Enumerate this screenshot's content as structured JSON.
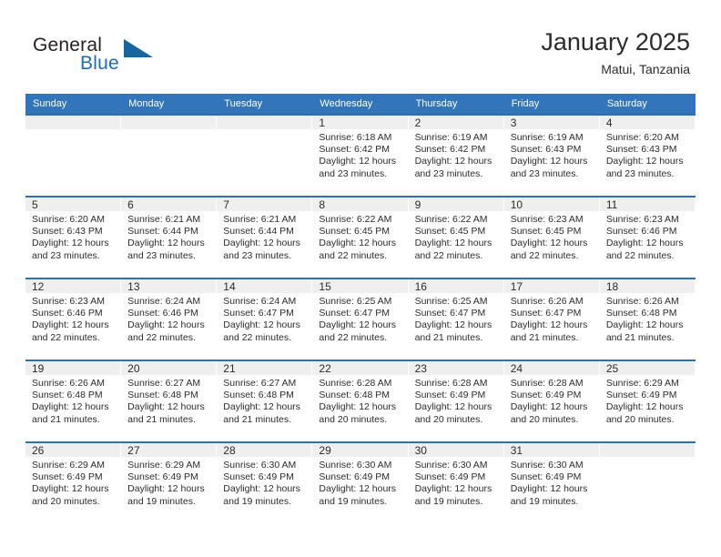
{
  "brand": {
    "name_part1": "General",
    "name_part2": "Blue",
    "triangle_color": "#15659e",
    "blue_color": "#1d6cb5"
  },
  "header": {
    "title": "January 2025",
    "subtitle": "Matui, Tanzania"
  },
  "theme": {
    "header_row_bg": "#3275bb",
    "row_divider": "#2f6fb0",
    "day_number_band_bg": "#efefef",
    "text": "#2b2b2b"
  },
  "weekdays": [
    "Sunday",
    "Monday",
    "Tuesday",
    "Wednesday",
    "Thursday",
    "Friday",
    "Saturday"
  ],
  "weeks": [
    [
      {
        "day": "",
        "sunrise": "",
        "sunset": "",
        "daylight1": "",
        "daylight2": ""
      },
      {
        "day": "",
        "sunrise": "",
        "sunset": "",
        "daylight1": "",
        "daylight2": ""
      },
      {
        "day": "",
        "sunrise": "",
        "sunset": "",
        "daylight1": "",
        "daylight2": ""
      },
      {
        "day": "1",
        "sunrise": "Sunrise: 6:18 AM",
        "sunset": "Sunset: 6:42 PM",
        "daylight1": "Daylight: 12 hours",
        "daylight2": "and 23 minutes."
      },
      {
        "day": "2",
        "sunrise": "Sunrise: 6:19 AM",
        "sunset": "Sunset: 6:42 PM",
        "daylight1": "Daylight: 12 hours",
        "daylight2": "and 23 minutes."
      },
      {
        "day": "3",
        "sunrise": "Sunrise: 6:19 AM",
        "sunset": "Sunset: 6:43 PM",
        "daylight1": "Daylight: 12 hours",
        "daylight2": "and 23 minutes."
      },
      {
        "day": "4",
        "sunrise": "Sunrise: 6:20 AM",
        "sunset": "Sunset: 6:43 PM",
        "daylight1": "Daylight: 12 hours",
        "daylight2": "and 23 minutes."
      }
    ],
    [
      {
        "day": "5",
        "sunrise": "Sunrise: 6:20 AM",
        "sunset": "Sunset: 6:43 PM",
        "daylight1": "Daylight: 12 hours",
        "daylight2": "and 23 minutes."
      },
      {
        "day": "6",
        "sunrise": "Sunrise: 6:21 AM",
        "sunset": "Sunset: 6:44 PM",
        "daylight1": "Daylight: 12 hours",
        "daylight2": "and 23 minutes."
      },
      {
        "day": "7",
        "sunrise": "Sunrise: 6:21 AM",
        "sunset": "Sunset: 6:44 PM",
        "daylight1": "Daylight: 12 hours",
        "daylight2": "and 23 minutes."
      },
      {
        "day": "8",
        "sunrise": "Sunrise: 6:22 AM",
        "sunset": "Sunset: 6:45 PM",
        "daylight1": "Daylight: 12 hours",
        "daylight2": "and 22 minutes."
      },
      {
        "day": "9",
        "sunrise": "Sunrise: 6:22 AM",
        "sunset": "Sunset: 6:45 PM",
        "daylight1": "Daylight: 12 hours",
        "daylight2": "and 22 minutes."
      },
      {
        "day": "10",
        "sunrise": "Sunrise: 6:23 AM",
        "sunset": "Sunset: 6:45 PM",
        "daylight1": "Daylight: 12 hours",
        "daylight2": "and 22 minutes."
      },
      {
        "day": "11",
        "sunrise": "Sunrise: 6:23 AM",
        "sunset": "Sunset: 6:46 PM",
        "daylight1": "Daylight: 12 hours",
        "daylight2": "and 22 minutes."
      }
    ],
    [
      {
        "day": "12",
        "sunrise": "Sunrise: 6:23 AM",
        "sunset": "Sunset: 6:46 PM",
        "daylight1": "Daylight: 12 hours",
        "daylight2": "and 22 minutes."
      },
      {
        "day": "13",
        "sunrise": "Sunrise: 6:24 AM",
        "sunset": "Sunset: 6:46 PM",
        "daylight1": "Daylight: 12 hours",
        "daylight2": "and 22 minutes."
      },
      {
        "day": "14",
        "sunrise": "Sunrise: 6:24 AM",
        "sunset": "Sunset: 6:47 PM",
        "daylight1": "Daylight: 12 hours",
        "daylight2": "and 22 minutes."
      },
      {
        "day": "15",
        "sunrise": "Sunrise: 6:25 AM",
        "sunset": "Sunset: 6:47 PM",
        "daylight1": "Daylight: 12 hours",
        "daylight2": "and 22 minutes."
      },
      {
        "day": "16",
        "sunrise": "Sunrise: 6:25 AM",
        "sunset": "Sunset: 6:47 PM",
        "daylight1": "Daylight: 12 hours",
        "daylight2": "and 21 minutes."
      },
      {
        "day": "17",
        "sunrise": "Sunrise: 6:26 AM",
        "sunset": "Sunset: 6:47 PM",
        "daylight1": "Daylight: 12 hours",
        "daylight2": "and 21 minutes."
      },
      {
        "day": "18",
        "sunrise": "Sunrise: 6:26 AM",
        "sunset": "Sunset: 6:48 PM",
        "daylight1": "Daylight: 12 hours",
        "daylight2": "and 21 minutes."
      }
    ],
    [
      {
        "day": "19",
        "sunrise": "Sunrise: 6:26 AM",
        "sunset": "Sunset: 6:48 PM",
        "daylight1": "Daylight: 12 hours",
        "daylight2": "and 21 minutes."
      },
      {
        "day": "20",
        "sunrise": "Sunrise: 6:27 AM",
        "sunset": "Sunset: 6:48 PM",
        "daylight1": "Daylight: 12 hours",
        "daylight2": "and 21 minutes."
      },
      {
        "day": "21",
        "sunrise": "Sunrise: 6:27 AM",
        "sunset": "Sunset: 6:48 PM",
        "daylight1": "Daylight: 12 hours",
        "daylight2": "and 21 minutes."
      },
      {
        "day": "22",
        "sunrise": "Sunrise: 6:28 AM",
        "sunset": "Sunset: 6:48 PM",
        "daylight1": "Daylight: 12 hours",
        "daylight2": "and 20 minutes."
      },
      {
        "day": "23",
        "sunrise": "Sunrise: 6:28 AM",
        "sunset": "Sunset: 6:49 PM",
        "daylight1": "Daylight: 12 hours",
        "daylight2": "and 20 minutes."
      },
      {
        "day": "24",
        "sunrise": "Sunrise: 6:28 AM",
        "sunset": "Sunset: 6:49 PM",
        "daylight1": "Daylight: 12 hours",
        "daylight2": "and 20 minutes."
      },
      {
        "day": "25",
        "sunrise": "Sunrise: 6:29 AM",
        "sunset": "Sunset: 6:49 PM",
        "daylight1": "Daylight: 12 hours",
        "daylight2": "and 20 minutes."
      }
    ],
    [
      {
        "day": "26",
        "sunrise": "Sunrise: 6:29 AM",
        "sunset": "Sunset: 6:49 PM",
        "daylight1": "Daylight: 12 hours",
        "daylight2": "and 20 minutes."
      },
      {
        "day": "27",
        "sunrise": "Sunrise: 6:29 AM",
        "sunset": "Sunset: 6:49 PM",
        "daylight1": "Daylight: 12 hours",
        "daylight2": "and 19 minutes."
      },
      {
        "day": "28",
        "sunrise": "Sunrise: 6:30 AM",
        "sunset": "Sunset: 6:49 PM",
        "daylight1": "Daylight: 12 hours",
        "daylight2": "and 19 minutes."
      },
      {
        "day": "29",
        "sunrise": "Sunrise: 6:30 AM",
        "sunset": "Sunset: 6:49 PM",
        "daylight1": "Daylight: 12 hours",
        "daylight2": "and 19 minutes."
      },
      {
        "day": "30",
        "sunrise": "Sunrise: 6:30 AM",
        "sunset": "Sunset: 6:49 PM",
        "daylight1": "Daylight: 12 hours",
        "daylight2": "and 19 minutes."
      },
      {
        "day": "31",
        "sunrise": "Sunrise: 6:30 AM",
        "sunset": "Sunset: 6:49 PM",
        "daylight1": "Daylight: 12 hours",
        "daylight2": "and 19 minutes."
      },
      {
        "day": "",
        "sunrise": "",
        "sunset": "",
        "daylight1": "",
        "daylight2": ""
      }
    ]
  ]
}
